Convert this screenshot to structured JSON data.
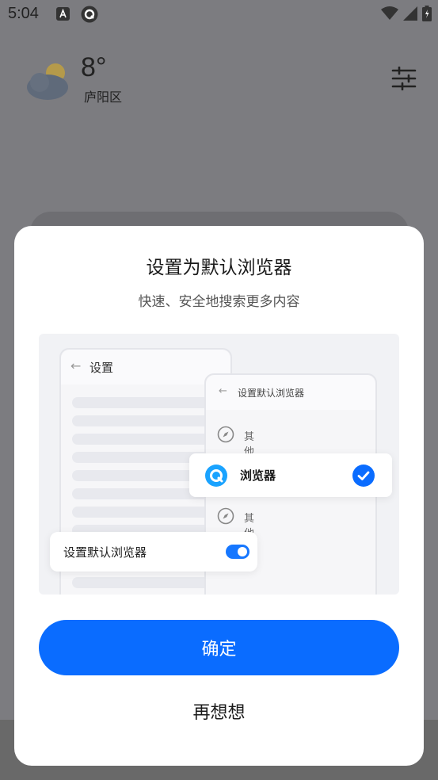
{
  "status_bar": {
    "time": "5:04"
  },
  "weather": {
    "temperature": "8°",
    "location": "庐阳区"
  },
  "dialog": {
    "title": "设置为默认浏览器",
    "subtitle": "快速、安全地搜索更多内容",
    "illustration": {
      "settings_title": "设置",
      "default_browser_title": "设置默认浏览器",
      "option_other_1": "其他",
      "option_browser": "浏览器",
      "option_other_2": "其他",
      "toggle_label": "设置默认浏览器",
      "toggle_on": true
    },
    "confirm_label": "确定",
    "later_label": "再想想"
  },
  "colors": {
    "accent": "#0a6cff",
    "toggle": "#1677ff",
    "overlay": "#7c7c80"
  },
  "icons": [
    "a-app-icon",
    "browser-app-icon",
    "wifi-icon",
    "signal-icon",
    "battery-icon",
    "weather-icon",
    "settings-sliders-icon",
    "back-arrow-icon",
    "compass-icon",
    "browser-logo-icon",
    "check-icon"
  ]
}
